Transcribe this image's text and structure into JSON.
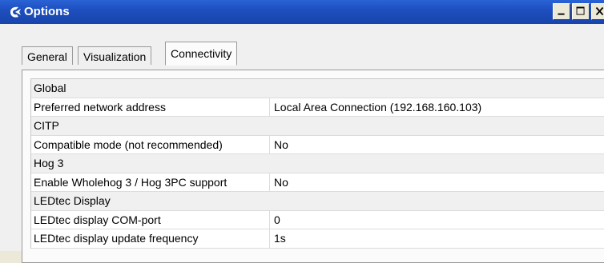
{
  "window": {
    "title": "Options",
    "controls": {
      "minimize": "_",
      "maximize": "□",
      "close": "X"
    }
  },
  "tabs": [
    {
      "label": "General",
      "active": false
    },
    {
      "label": "Visualization",
      "active": false
    },
    {
      "label": "Connectivity",
      "active": true
    }
  ],
  "property_grid": {
    "rows": [
      {
        "type": "category",
        "name": "Global"
      },
      {
        "type": "property",
        "name": "Preferred network address",
        "value": "Local Area Connection (192.168.160.103)"
      },
      {
        "type": "category",
        "name": "CITP"
      },
      {
        "type": "property",
        "name": "Compatible mode (not recommended)",
        "value": "No"
      },
      {
        "type": "category",
        "name": "Hog 3"
      },
      {
        "type": "property",
        "name": "Enable Wholehog 3 / Hog 3PC support",
        "value": "No"
      },
      {
        "type": "category",
        "name": "LEDtec Display"
      },
      {
        "type": "property",
        "name": "LEDtec display COM-port",
        "value": "0"
      },
      {
        "type": "property",
        "name": "LEDtec display update frequency",
        "value": "1s"
      }
    ]
  },
  "colors": {
    "titlebar": "#1e4fbf",
    "category_bg": "#f0f0f0",
    "property_bg": "#ffffff"
  },
  "icons": {
    "app": "app-logo-icon"
  }
}
